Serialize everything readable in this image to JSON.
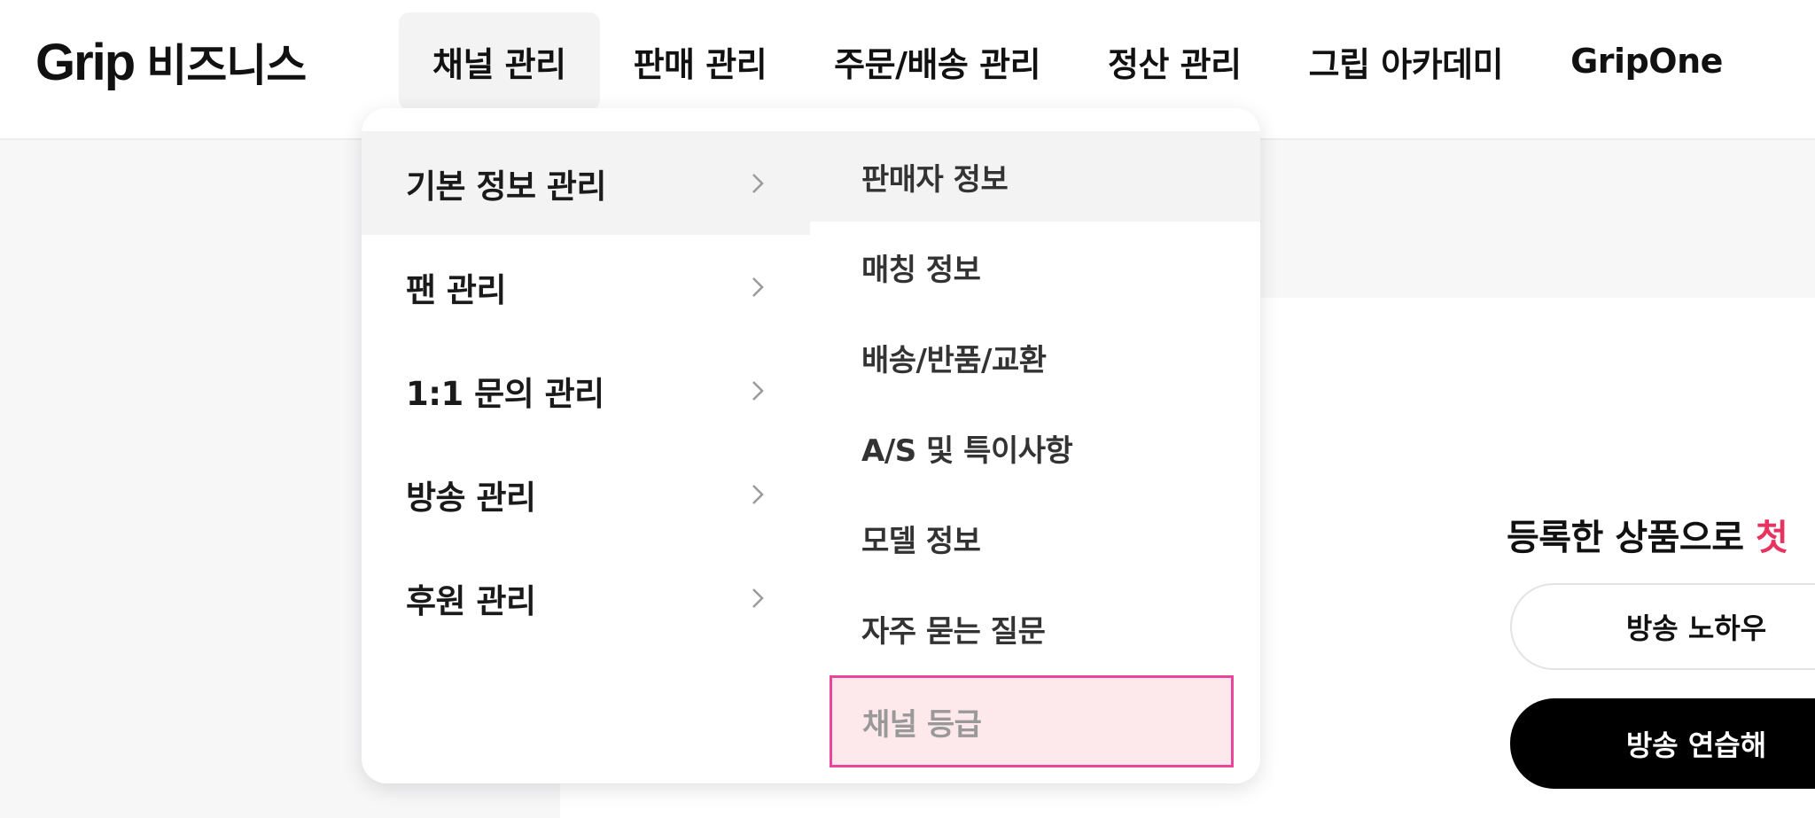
{
  "header": {
    "logo_word": "Grip",
    "logo_sub": "비즈니스",
    "nav": [
      {
        "label": "채널 관리"
      },
      {
        "label": "판매 관리"
      },
      {
        "label": "주문/배송 관리"
      },
      {
        "label": "정산 관리"
      },
      {
        "label": "그립 아카데미"
      },
      {
        "label": "GripOne"
      }
    ]
  },
  "dropdown": {
    "categories": [
      {
        "label": "기본 정보 관리"
      },
      {
        "label": "팬 관리"
      },
      {
        "label": "1:1 문의 관리"
      },
      {
        "label": "방송 관리"
      },
      {
        "label": "후원 관리"
      }
    ],
    "subitems": [
      {
        "label": "판매자 정보"
      },
      {
        "label": "매칭 정보"
      },
      {
        "label": "배송/반품/교환"
      },
      {
        "label": "A/S 및 특이사항"
      },
      {
        "label": "모델 정보"
      },
      {
        "label": "자주 묻는 질문"
      },
      {
        "label": "채널 등급"
      }
    ]
  },
  "main": {
    "promo_text": "등록한 상품으로 ",
    "promo_accent": "첫",
    "btn_outline": "방송 노하우",
    "btn_solid": "방송 연습해"
  },
  "colors": {
    "accent": "#e8335f",
    "highlight_border": "#e8469a",
    "highlight_fill": "#fde8ec"
  }
}
